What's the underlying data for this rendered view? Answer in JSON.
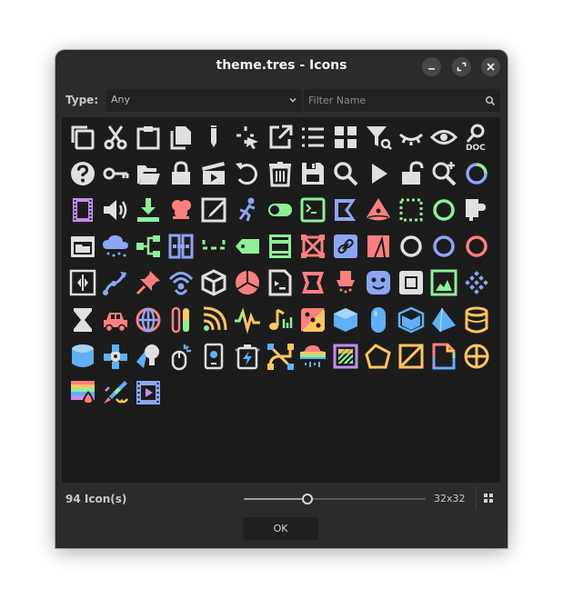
{
  "window": {
    "title": "theme.tres - Icons",
    "minimize_label": "minimize",
    "maximize_label": "maximize",
    "close_label": "close"
  },
  "filter": {
    "type_label": "Type:",
    "type_value": "Any",
    "name_placeholder": "Filter Name",
    "name_value": ""
  },
  "icons": [
    {
      "name": "copy-icon",
      "colors": [
        "#e0e0e0"
      ]
    },
    {
      "name": "cut-icon",
      "colors": [
        "#e0e0e0"
      ]
    },
    {
      "name": "paste-icon",
      "colors": [
        "#e0e0e0"
      ]
    },
    {
      "name": "duplicate-icon",
      "colors": [
        "#e0e0e0"
      ]
    },
    {
      "name": "edit-pencil-icon",
      "colors": [
        "#e0e0e0"
      ]
    },
    {
      "name": "select-cursor-icon",
      "colors": [
        "#e0e0e0"
      ]
    },
    {
      "name": "external-link-icon",
      "colors": [
        "#e0e0e0"
      ]
    },
    {
      "name": "list-icon",
      "colors": [
        "#e0e0e0"
      ]
    },
    {
      "name": "grid-icon",
      "colors": [
        "#e0e0e0"
      ]
    },
    {
      "name": "filter-search-icon",
      "colors": [
        "#e0e0e0"
      ]
    },
    {
      "name": "eye-closed-icon",
      "colors": [
        "#e0e0e0"
      ]
    },
    {
      "name": "eye-icon",
      "colors": [
        "#e0e0e0"
      ]
    },
    {
      "name": "search-doc-icon",
      "colors": [
        "#e0e0e0"
      ]
    },
    {
      "name": "help-icon",
      "colors": [
        "#e0e0e0"
      ]
    },
    {
      "name": "key-icon",
      "colors": [
        "#e0e0e0"
      ]
    },
    {
      "name": "folder-open-icon",
      "colors": [
        "#e0e0e0"
      ]
    },
    {
      "name": "lock-icon",
      "colors": [
        "#e0e0e0"
      ]
    },
    {
      "name": "clapperboard-icon",
      "colors": [
        "#e0e0e0"
      ]
    },
    {
      "name": "undo-icon",
      "colors": [
        "#e0e0e0"
      ]
    },
    {
      "name": "trash-icon",
      "colors": [
        "#e0e0e0"
      ]
    },
    {
      "name": "save-icon",
      "colors": [
        "#e0e0e0"
      ]
    },
    {
      "name": "magnifier-icon",
      "colors": [
        "#e0e0e0"
      ]
    },
    {
      "name": "play-icon",
      "colors": [
        "#e0e0e0"
      ]
    },
    {
      "name": "unlock-icon",
      "colors": [
        "#e0e0e0"
      ]
    },
    {
      "name": "zoom-in-icon",
      "colors": [
        "#e0e0e0"
      ]
    },
    {
      "name": "circle-progress-icon",
      "colors": [
        "#8eef97",
        "#8da5f3"
      ]
    },
    {
      "name": "film-icon",
      "colors": [
        "#c38ef1"
      ]
    },
    {
      "name": "audio-icon",
      "colors": [
        "#e0e0e0"
      ]
    },
    {
      "name": "import-icon",
      "colors": [
        "#8eef97"
      ]
    },
    {
      "name": "particles-icon",
      "colors": [
        "#fc7f7f"
      ]
    },
    {
      "name": "paint-edit-icon",
      "colors": [
        "#e0e0e0"
      ]
    },
    {
      "name": "skeleton-icon",
      "colors": [
        "#8da5f3"
      ]
    },
    {
      "name": "toggle-icon",
      "colors": [
        "#8eef97"
      ]
    },
    {
      "name": "terminal-icon",
      "colors": [
        "#8eef97"
      ]
    },
    {
      "name": "shape-k-icon",
      "colors": [
        "#8da5f3"
      ]
    },
    {
      "name": "cone-light-icon",
      "colors": [
        "#fc7f7f"
      ]
    },
    {
      "name": "dashed-rect-icon",
      "colors": [
        "#8eef97"
      ]
    },
    {
      "name": "ring-green-icon",
      "colors": [
        "#8eef97"
      ]
    },
    {
      "name": "plugin-icon",
      "colors": [
        "#e0e0e0"
      ]
    },
    {
      "name": "window-icon",
      "colors": [
        "#e0e0e0"
      ]
    },
    {
      "name": "cloud-rain-icon",
      "colors": [
        "#8da5f3"
      ]
    },
    {
      "name": "tree-nodes-icon",
      "colors": [
        "#8eef97"
      ]
    },
    {
      "name": "split-container-icon",
      "colors": [
        "#8da5f3"
      ]
    },
    {
      "name": "dash-line-icon",
      "colors": [
        "#8eef97"
      ]
    },
    {
      "name": "tag-icon",
      "colors": [
        "#8eef97"
      ]
    },
    {
      "name": "panel-box-icon",
      "colors": [
        "#8eef97"
      ]
    },
    {
      "name": "cross-rect-icon",
      "colors": [
        "#fc7f7f"
      ]
    },
    {
      "name": "link-icon",
      "colors": [
        "#8da5f3"
      ]
    },
    {
      "name": "mesh-a-icon",
      "colors": [
        "#fc7f7f"
      ]
    },
    {
      "name": "ring-white-icon",
      "colors": [
        "#e0e0e0"
      ]
    },
    {
      "name": "ring-blue-icon",
      "colors": [
        "#8da5f3"
      ]
    },
    {
      "name": "ring-red-icon",
      "colors": [
        "#fc7f7f"
      ]
    },
    {
      "name": "code-box-icon",
      "colors": [
        "#e0e0e0"
      ]
    },
    {
      "name": "curve-path-icon",
      "colors": [
        "#8da5f3"
      ]
    },
    {
      "name": "pin-icon",
      "colors": [
        "#fc7f7f"
      ]
    },
    {
      "name": "signal-person-icon",
      "colors": [
        "#8da5f3"
      ]
    },
    {
      "name": "cube-outline-icon",
      "colors": [
        "#e0e0e0"
      ]
    },
    {
      "name": "pie-ball-icon",
      "colors": [
        "#fc7f7f"
      ]
    },
    {
      "name": "script-doc-icon",
      "colors": [
        "#e0e0e0"
      ]
    },
    {
      "name": "shape-s-icon",
      "colors": [
        "#fc7f7f"
      ]
    },
    {
      "name": "lamp-icon",
      "colors": [
        "#fc7f7f"
      ]
    },
    {
      "name": "face-icon",
      "colors": [
        "#8da5f3"
      ]
    },
    {
      "name": "frame-square-icon",
      "colors": [
        "#e0e0e0"
      ]
    },
    {
      "name": "image-texture-icon",
      "colors": [
        "#8eef97"
      ]
    },
    {
      "name": "diamond-grid-icon",
      "colors": [
        "#8da5f3"
      ]
    },
    {
      "name": "hourglass-icon",
      "colors": [
        "#e0e0e0"
      ]
    },
    {
      "name": "car-icon",
      "colors": [
        "#fc7f7f"
      ]
    },
    {
      "name": "globe-icon",
      "colors": [
        "#fc7f7f",
        "#8da5f3"
      ]
    },
    {
      "name": "gradient-bars-icon",
      "colors": [
        "#fc7f7f",
        "#ffc562",
        "#8eef97"
      ]
    },
    {
      "name": "wifi-arc-icon",
      "colors": [
        "#8eef97",
        "#ffc562"
      ]
    },
    {
      "name": "waveform-icon",
      "colors": [
        "#8eef97",
        "#ffc562"
      ]
    },
    {
      "name": "music-icon",
      "colors": [
        "#ffc562",
        "#8eef97"
      ]
    },
    {
      "name": "dice-icon",
      "colors": [
        "#fc7f7f",
        "#ffc562"
      ]
    },
    {
      "name": "cube-blue-icon",
      "colors": [
        "#5fb0f6"
      ]
    },
    {
      "name": "capsule-icon",
      "colors": [
        "#5fb0f6"
      ]
    },
    {
      "name": "box-blue-icon",
      "colors": [
        "#5fb0f6"
      ]
    },
    {
      "name": "prism-icon",
      "colors": [
        "#5fb0f6"
      ]
    },
    {
      "name": "cylinder-yellow-icon",
      "colors": [
        "#ffc562"
      ]
    },
    {
      "name": "cylinder-blue-icon",
      "colors": [
        "#5fb0f6"
      ]
    },
    {
      "name": "joints-icon",
      "colors": [
        "#5fb0f6",
        "#e0e0e0"
      ]
    },
    {
      "name": "bulb-light-icon",
      "colors": [
        "#5fb0f6",
        "#e0e0e0"
      ]
    },
    {
      "name": "mouse-sparkle-icon",
      "colors": [
        "#5fb0f6",
        "#e0e0e0"
      ]
    },
    {
      "name": "device-icon",
      "colors": [
        "#5fb0f6",
        "#e0e0e0"
      ]
    },
    {
      "name": "battery-bolt-icon",
      "colors": [
        "#5fb0f6",
        "#e0e0e0"
      ]
    },
    {
      "name": "bezier-nodes-icon",
      "colors": [
        "#ffc562",
        "#5fb0f6"
      ]
    },
    {
      "name": "rainbow-cloud-icon",
      "colors": [
        "#fc7f7f",
        "#ffc562",
        "#8eef97",
        "#5fb0f6"
      ]
    },
    {
      "name": "stripe-square-icon",
      "colors": [
        "#ffc562",
        "#8eef97",
        "#c38ef1"
      ]
    },
    {
      "name": "pentagon-icon",
      "colors": [
        "#ffc562"
      ]
    },
    {
      "name": "diagonal-box-icon",
      "colors": [
        "#ffc562"
      ]
    },
    {
      "name": "rainbow-doc-icon",
      "colors": [
        "#fc7f7f",
        "#ffc562",
        "#8eef97",
        "#5fb0f6",
        "#c38ef1"
      ]
    },
    {
      "name": "crosshair-circle-icon",
      "colors": [
        "#ffc562"
      ]
    },
    {
      "name": "rainbow-drop-icon",
      "colors": [
        "#fc7f7f",
        "#ffc562",
        "#8eef97",
        "#5fb0f6",
        "#c38ef1"
      ]
    },
    {
      "name": "rainbow-brush-icon",
      "colors": [
        "#fc7f7f",
        "#ffc562",
        "#8eef97",
        "#5fb0f6",
        "#c38ef1"
      ]
    },
    {
      "name": "video-film-icon",
      "colors": [
        "#8da5f3",
        "#c38ef1"
      ]
    }
  ],
  "footer": {
    "count_label": "94 Icon(s)",
    "zoom_fraction": 0.35,
    "size_label": "32x32",
    "ok_label": "OK"
  },
  "colors": {
    "white": "#e0e0e0",
    "green": "#8eef97",
    "blue": "#8da5f3",
    "red": "#fc7f7f",
    "yellow": "#ffc562",
    "purple": "#c38ef1",
    "sky": "#5fb0f6"
  }
}
